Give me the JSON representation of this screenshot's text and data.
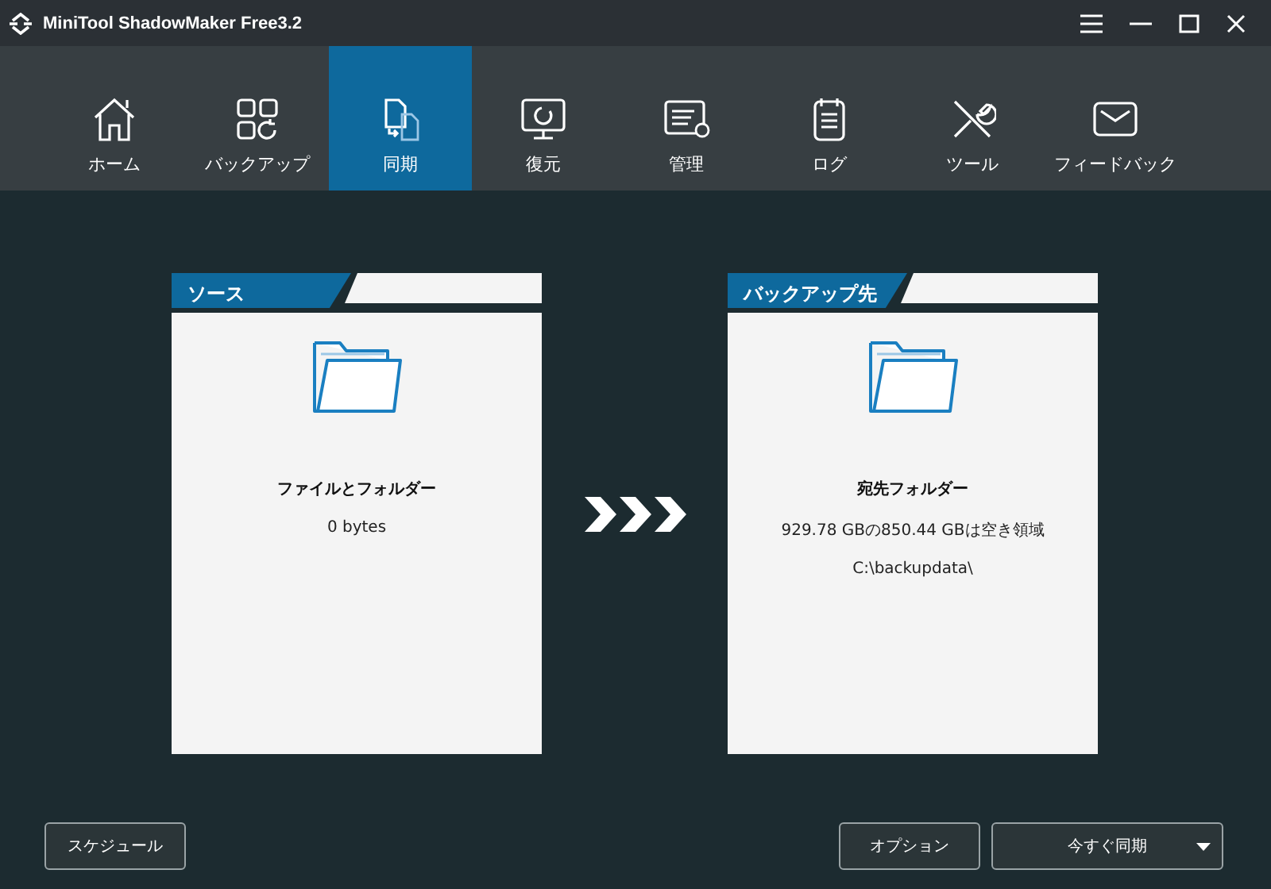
{
  "window": {
    "title": "MiniTool ShadowMaker Free3.2"
  },
  "tabs": [
    {
      "label": "ホーム",
      "selected": false
    },
    {
      "label": "バックアップ",
      "selected": false
    },
    {
      "label": "同期",
      "selected": true
    },
    {
      "label": "復元",
      "selected": false
    },
    {
      "label": "管理",
      "selected": false
    },
    {
      "label": "ログ",
      "selected": false
    },
    {
      "label": "ツール",
      "selected": false
    },
    {
      "label": "フィードバック",
      "selected": false
    }
  ],
  "cards": [
    {
      "title": "ソース",
      "heading": "ファイルとフォルダー",
      "lines": [
        "0 bytes"
      ]
    },
    {
      "title": "バックアップ先",
      "heading": "宛先フォルダー",
      "lines": [
        "929.78 GBの850.44 GBは空き領域",
        "C:\\backupdata\\"
      ]
    }
  ],
  "buttons": {
    "left": [
      {
        "label": "スケジュール"
      }
    ],
    "right": [
      {
        "label": "オプション",
        "dropdown": false
      },
      {
        "label": "今すぐ同期",
        "dropdown": true
      }
    ]
  }
}
